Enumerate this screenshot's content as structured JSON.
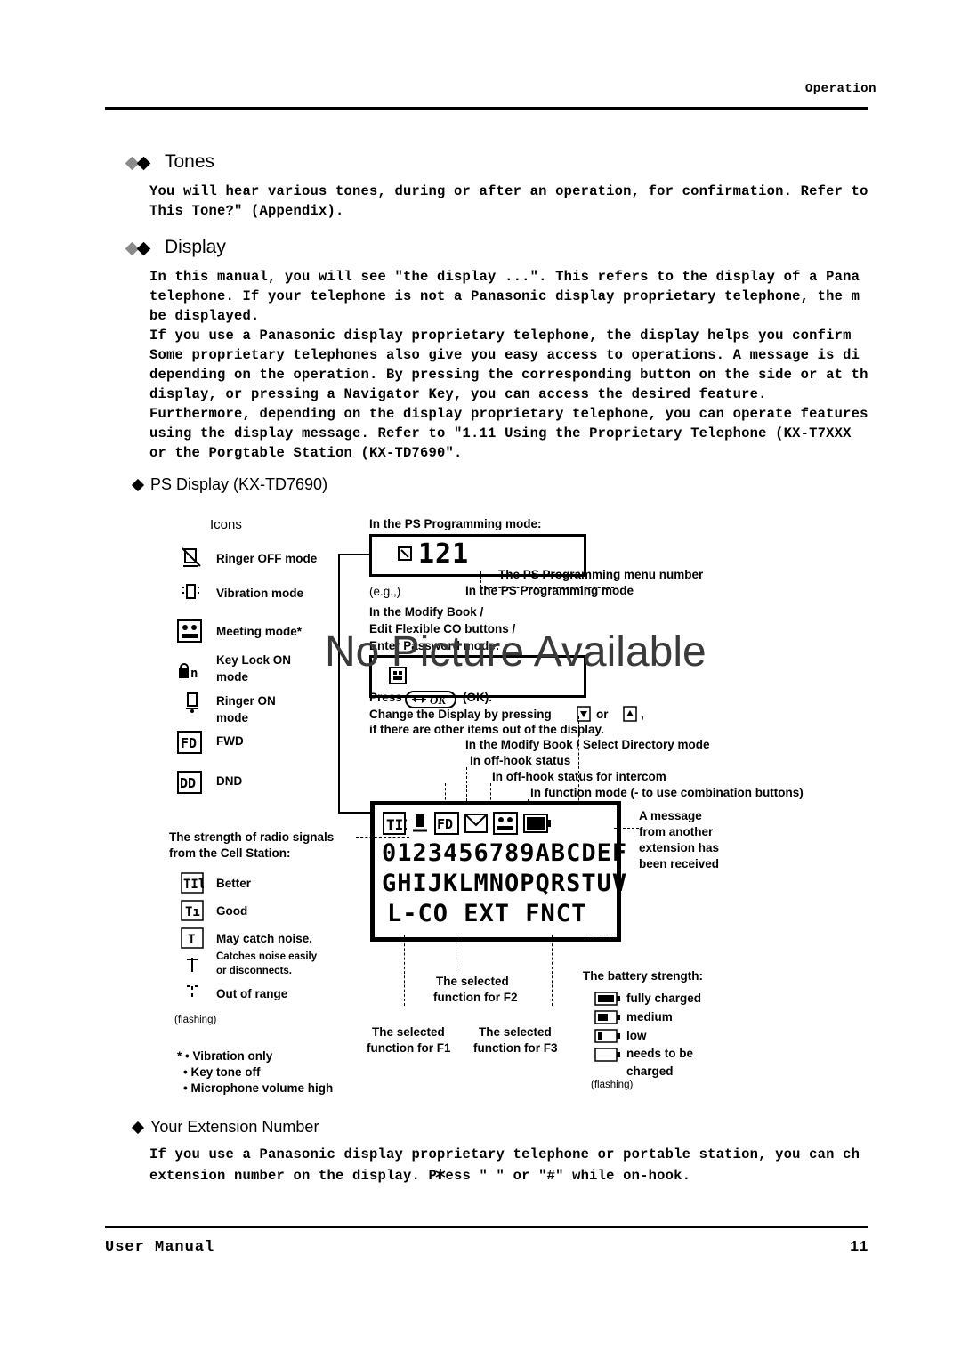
{
  "header": {
    "section": "Operation"
  },
  "footer": {
    "manual": "User Manual",
    "page": "11"
  },
  "tones": {
    "heading": "Tones",
    "body_line1": "You will hear various tones, during or after an operation, for confirmation. Refer to",
    "body_line2": "This Tone?\" (Appendix)."
  },
  "display": {
    "heading": "Display",
    "p1_l1": "In this manual, you will see \"the display ...\". This refers to the display of a Pana",
    "p1_l2": "telephone. If your telephone is not a Panasonic display proprietary telephone, the m",
    "p1_l3": "be displayed.",
    "p2_l1": "If you use a Panasonic display proprietary telephone, the display helps you confirm",
    "p3_l1": "Some proprietary telephones also give you easy access to operations. A message is di",
    "p3_l2": "depending on the operation. By pressing the corresponding button on the side or at th",
    "p3_l3": "display, or pressing a Navigator Key, you can access the desired feature.",
    "p4_l1": "Furthermore, depending on the display proprietary telephone, you can operate features",
    "p4_l2": "using the display message. Refer to \"1.11 Using the Proprietary Telephone (KX-T7XXX",
    "p4_l3": "or the Porgtable Station (KX-TD7690\"."
  },
  "ps_display": {
    "heading": "PS Display (KX-TD7690)",
    "icons_title": "Icons",
    "icon_items": [
      {
        "label": "Ringer OFF mode"
      },
      {
        "label": "Vibration mode"
      },
      {
        "label": "Meeting mode*"
      },
      {
        "label": "Key Lock ON",
        "label2": "mode"
      },
      {
        "label": "Ringer ON",
        "label2": "mode"
      },
      {
        "label": "FWD"
      },
      {
        "label": "DND"
      }
    ],
    "prog_mode_title": "In the PS Programming mode:",
    "callout_menu_number": "The PS Programming menu number",
    "callout_in_prog_mode": "In the PS Programming mode",
    "eg": "(e.g.,)",
    "modify_book": "In the Modify Book /",
    "edit_flex": "Edit Flexible CO buttons /",
    "enter_pw": "Enter Password mode:",
    "press_ok_a": "Press",
    "press_ok_b": "(OK).",
    "ok_button": "OK",
    "change_display_1": "Change the Display by pressing",
    "change_display_2": "or",
    "change_display_3": ",",
    "change_display_4": "if there are other items out of the display.",
    "select_dir": "In the Modify Book / Select Directory mode",
    "offhook": "In off-hook status",
    "offhook_intercom": "In off-hook status for intercom",
    "function_mode": "In function mode (- to use combination buttons)",
    "signal_title_1": "The strength of radio signals",
    "signal_title_2": "from the Cell Station:",
    "signal_items": [
      {
        "label": "Better"
      },
      {
        "label": "Good"
      },
      {
        "label": "May catch noise."
      },
      {
        "label": "Catches noise easily",
        "label2": "or disconnects."
      },
      {
        "label": "Out of range"
      }
    ],
    "flashing_1": "(flashing)",
    "note_1": "* • Vibration only",
    "note_2": "• Key tone off",
    "note_3": "• Microphone volume high",
    "message_rx_1": "A message",
    "message_rx_2": "from another",
    "message_rx_3": "extension has",
    "message_rx_4": "been received",
    "battery_title": "The battery strength:",
    "battery_items": [
      {
        "label": "fully charged"
      },
      {
        "label": "medium"
      },
      {
        "label": "low"
      },
      {
        "label": "needs to be",
        "label2": "charged"
      }
    ],
    "flashing_2": "(flashing)",
    "f2_1": "The selected",
    "f2_2": "function for F2",
    "f1_1": "The selected",
    "f1_2": "function for F1",
    "f3_1": "The selected",
    "f3_2": "function for F3",
    "lcd_menu_number": "121",
    "lcd_line_1": "0123456789ABCDEF",
    "lcd_line_2": "GHIJKLMNOPQRSTUV",
    "lcd_line_3": "L-CO EXT  FNCT"
  },
  "extension": {
    "heading": "Your Extension Number",
    "body_l1": "If you use a Panasonic display proprietary telephone or portable station, you can ch",
    "body_l2": "extension number on the display. Press \" \" or \"#\" while on-hook."
  },
  "watermark": "No Picture Available"
}
